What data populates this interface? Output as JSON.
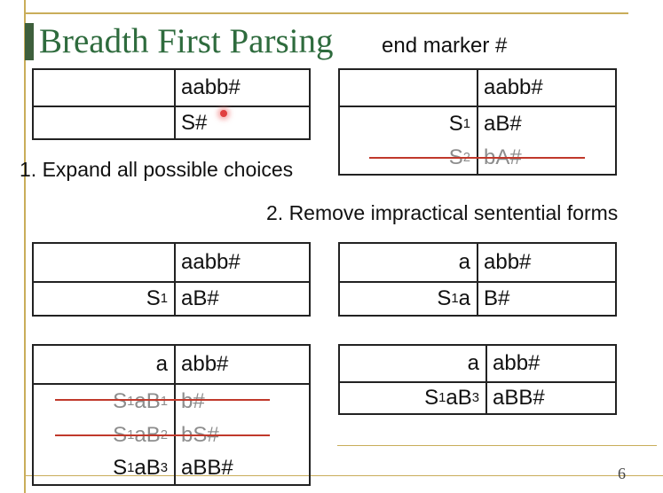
{
  "slide": {
    "title": "Breadth First Parsing",
    "end_marker_note": "end marker #",
    "step1": "1. Expand all possible choices",
    "step2": "2. Remove impractical sentential forms",
    "page_number": "6"
  },
  "table1": {
    "rows": [
      {
        "left": "",
        "right": "aabb#"
      },
      {
        "left": "",
        "right": "S#"
      }
    ]
  },
  "table2": {
    "rows": [
      {
        "left": "",
        "right": "aabb#"
      },
      {
        "left_main": "S",
        "left_sub": "1",
        "right": "aB#"
      },
      {
        "left_main": "S",
        "left_sub": "2",
        "right": "bA#"
      }
    ]
  },
  "table3": {
    "rows": [
      {
        "left": "",
        "right": "aabb#"
      },
      {
        "left_main": "S",
        "left_sub": "1",
        "right": "aB#"
      }
    ]
  },
  "table4": {
    "rows": [
      {
        "left": "a",
        "right": "abb#"
      },
      {
        "left_main": "S",
        "left_sub": "1",
        "left_tail": "a",
        "right": "B#"
      }
    ]
  },
  "table5": {
    "rows": [
      {
        "left": "a",
        "right": "abb#"
      },
      {
        "p1": "S",
        "s1": "1",
        "p2": "aB",
        "s2": "1",
        "right": "b#"
      },
      {
        "p1": "S",
        "s1": "1",
        "p2": "aB",
        "s2": "2",
        "right": "bS#"
      },
      {
        "p1": "S",
        "s1": "1",
        "p2": "aB",
        "s2": "3",
        "right": "aBB#"
      }
    ]
  },
  "table6": {
    "rows": [
      {
        "left": "a",
        "right": "abb#"
      },
      {
        "p1": "S",
        "s1": "1",
        "p2": "aB",
        "s2": "3",
        "right": "aBB#"
      }
    ]
  }
}
